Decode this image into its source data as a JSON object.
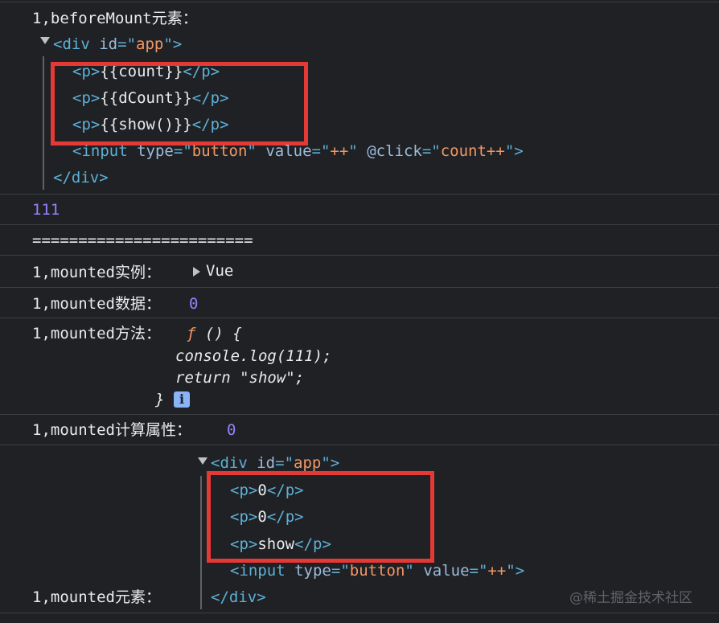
{
  "log1": {
    "label": "1,beforeMount元素：",
    "element": {
      "open_tag": "div",
      "id_attr": "id",
      "id_value": "app",
      "children": [
        {
          "tag": "p",
          "text": "{{count}}"
        },
        {
          "tag": "p",
          "text": "{{dCount}}"
        },
        {
          "tag": "p",
          "text": "{{show()}}"
        }
      ],
      "input": {
        "tag": "input",
        "type_attr": "type",
        "type_value": "button",
        "value_attr": "value",
        "value_value": "++",
        "click_attr": "@click",
        "click_value": "count++"
      },
      "close_tag": "div"
    }
  },
  "log2": {
    "value": "111"
  },
  "log3": {
    "value": "========================"
  },
  "log4": {
    "label": "1,mounted实例：",
    "object": "Vue"
  },
  "log5": {
    "label": "1,mounted数据：",
    "value": "0"
  },
  "log6": {
    "label": "1,mounted方法：",
    "f": "ƒ",
    "signature": "() {",
    "line1": "console.log(111);",
    "line2_kw": "return",
    "line2_str": "\"show\";",
    "close": "}",
    "info": "i"
  },
  "log7": {
    "label": "1,mounted计算属性：",
    "value": "0"
  },
  "log8": {
    "label": "1,mounted元素：",
    "element": {
      "open_tag": "div",
      "id_attr": "id",
      "id_value": "app",
      "children": [
        {
          "tag": "p",
          "text": "0"
        },
        {
          "tag": "p",
          "text": "0"
        },
        {
          "tag": "p",
          "text": "show"
        }
      ],
      "input": {
        "tag": "input",
        "type_attr": "type",
        "type_value": "button",
        "value_attr": "value",
        "value_value": "++"
      },
      "close_tag": "div"
    }
  },
  "watermark": "@稀土掘金技术社区",
  "colors": {
    "background": "#202124",
    "tag": "#5db0d7",
    "attr_value": "#f29766",
    "number": "#9980ff",
    "highlight_box": "#e53935"
  }
}
